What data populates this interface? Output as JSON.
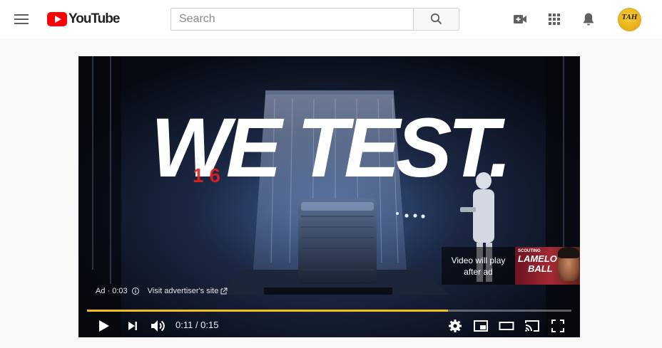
{
  "header": {
    "logo_text": "YouTube",
    "search_placeholder": "Search",
    "icons": [
      "menu-icon",
      "youtube-logo-icon",
      "search-icon",
      "create-video-icon",
      "apps-grid-icon",
      "notifications-bell-icon"
    ],
    "avatar_text": "TAH"
  },
  "player": {
    "headline": "WE TEST.",
    "overlay_number": "1 6",
    "ad_label": "Ad · 0:03",
    "visit_link": "Visit advertiser's site",
    "up_next": {
      "text": "Video will play after ad",
      "thumbnail_kicker": "SCOUTING",
      "thumbnail_name_first": "LAMELO",
      "thumbnail_name_last": "BALL"
    },
    "time_display": "0:11 / 0:15",
    "progress_fraction": 0.745,
    "progress_color": "#f0bf1b",
    "controls": [
      "play-icon",
      "next-icon",
      "volume-icon",
      "settings-icon",
      "miniplayer-icon",
      "theater-mode-icon",
      "cast-icon",
      "fullscreen-icon"
    ]
  },
  "colors": {
    "brand_red": "#ff0000",
    "ad_progress": "#f0bf1b",
    "header_bg": "#ffffff",
    "page_bg": "#f9f9f9"
  }
}
